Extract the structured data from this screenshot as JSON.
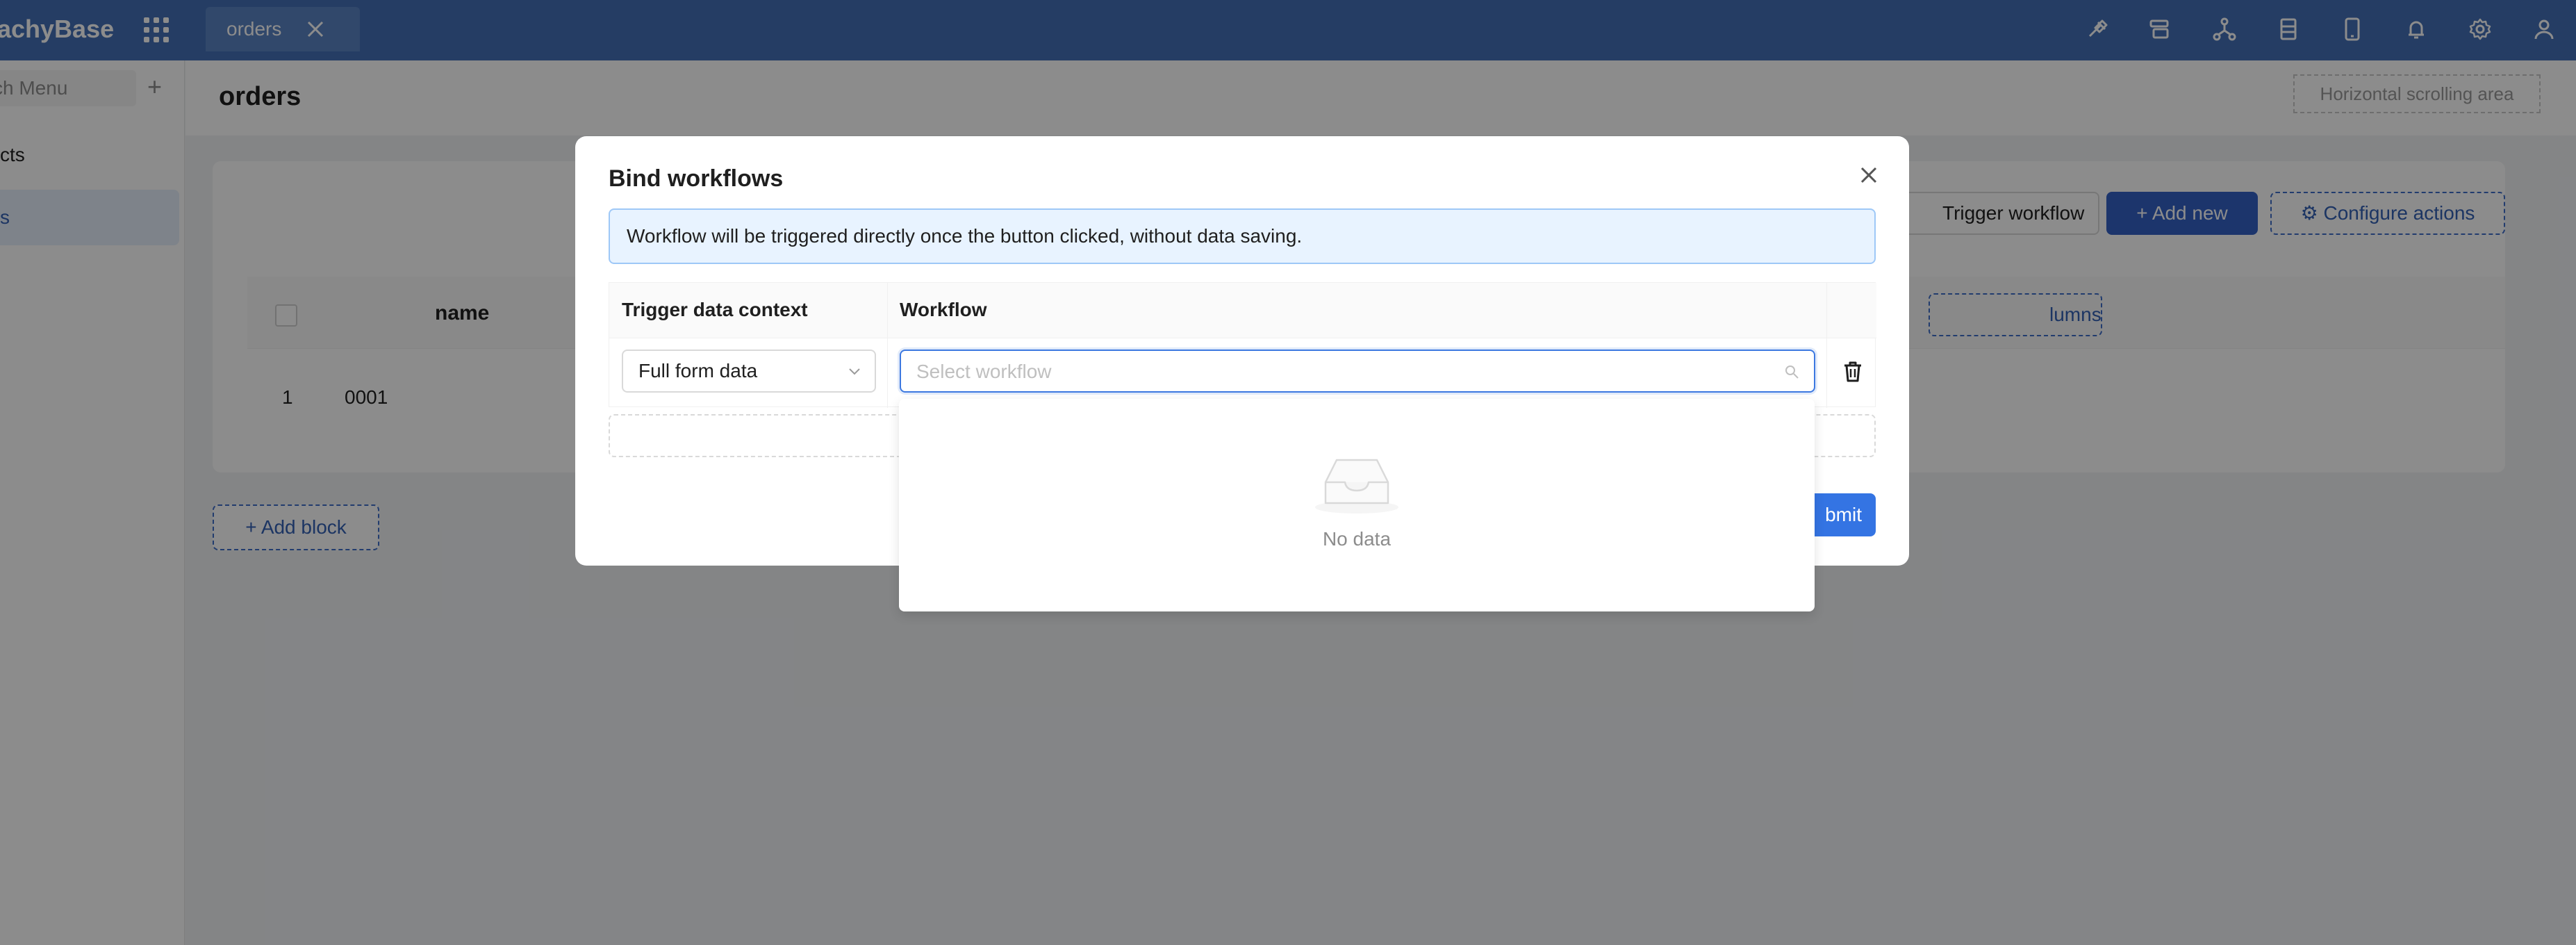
{
  "topbar": {
    "brand": "achyBase",
    "tab_label": "orders",
    "icons": [
      "brush-icon",
      "layout-icon",
      "workflow-icon",
      "database-icon",
      "mobile-icon",
      "bell-icon",
      "gear-icon",
      "user-icon"
    ]
  },
  "sidebar": {
    "search_placeholder": "ch Menu",
    "items": [
      {
        "label": "cts"
      },
      {
        "label": "s"
      }
    ]
  },
  "page": {
    "title": "orders",
    "horizontal_scrolling": "Horizontal scrolling area"
  },
  "table_block": {
    "actions": {
      "trigger_workflow": "Trigger workflow",
      "add_new": "Add new",
      "configure_actions": "Configure actions"
    },
    "columns": {
      "name": "name",
      "configure_columns": "lumns"
    },
    "rows": [
      {
        "index": "1",
        "name": "0001"
      }
    ],
    "add_block": "Add block"
  },
  "modal": {
    "title": "Bind workflows",
    "alert": "Workflow will be triggered directly once the button clicked, without data saving.",
    "table": {
      "header_context": "Trigger data context",
      "header_workflow": "Workflow",
      "context_value": "Full form data",
      "workflow_placeholder": "Select workflow"
    },
    "submit": "bmit"
  },
  "dropdown": {
    "empty_text": "No data"
  },
  "colors": {
    "primary": "#3461c5",
    "topbar": "#4470b7",
    "alert_bg": "#e8f3ff"
  }
}
